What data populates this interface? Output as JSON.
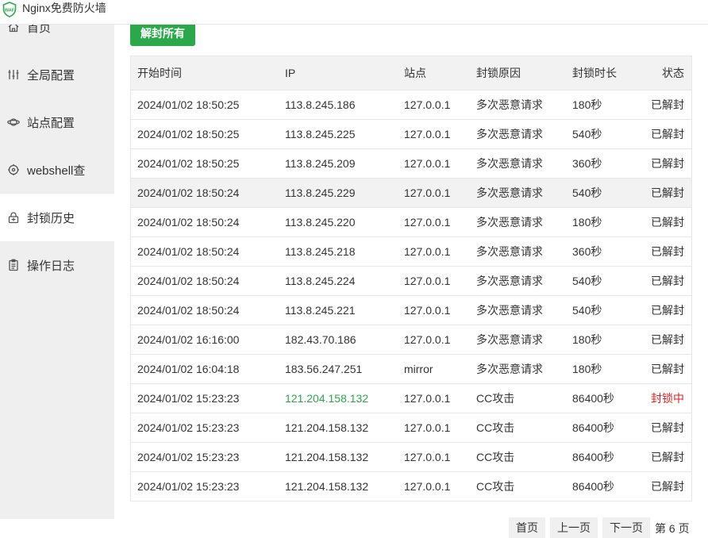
{
  "app": {
    "title": "Nginx免费防火墙",
    "logo_text": "WAF"
  },
  "sidebar": {
    "items": [
      {
        "label": "首页",
        "icon": "home-icon"
      },
      {
        "label": "全局配置",
        "icon": "sliders-icon"
      },
      {
        "label": "站点配置",
        "icon": "planet-icon"
      },
      {
        "label": "webshell查",
        "icon": "target-icon"
      },
      {
        "label": "封锁历史",
        "icon": "lock-icon",
        "active": true
      },
      {
        "label": "操作日志",
        "icon": "clipboard-icon"
      }
    ]
  },
  "toolbar": {
    "unblock_all_label": "解封所有"
  },
  "table": {
    "headers": [
      "开始时间",
      "IP",
      "站点",
      "封锁原因",
      "封锁时长",
      "状态"
    ],
    "rows": [
      [
        "2024/01/02 18:50:25",
        "113.8.245.186",
        "127.0.0.1",
        "多次恶意请求",
        "180秒",
        "已解封"
      ],
      [
        "2024/01/02 18:50:25",
        "113.8.245.225",
        "127.0.0.1",
        "多次恶意请求",
        "540秒",
        "已解封"
      ],
      [
        "2024/01/02 18:50:25",
        "113.8.245.209",
        "127.0.0.1",
        "多次恶意请求",
        "360秒",
        "已解封"
      ],
      [
        "2024/01/02 18:50:24",
        "113.8.245.229",
        "127.0.0.1",
        "多次恶意请求",
        "540秒",
        "已解封"
      ],
      [
        "2024/01/02 18:50:24",
        "113.8.245.220",
        "127.0.0.1",
        "多次恶意请求",
        "180秒",
        "已解封"
      ],
      [
        "2024/01/02 18:50:24",
        "113.8.245.218",
        "127.0.0.1",
        "多次恶意请求",
        "360秒",
        "已解封"
      ],
      [
        "2024/01/02 18:50:24",
        "113.8.245.224",
        "127.0.0.1",
        "多次恶意请求",
        "540秒",
        "已解封"
      ],
      [
        "2024/01/02 18:50:24",
        "113.8.245.221",
        "127.0.0.1",
        "多次恶意请求",
        "540秒",
        "已解封"
      ],
      [
        "2024/01/02 16:16:00",
        "182.43.70.186",
        "127.0.0.1",
        "多次恶意请求",
        "180秒",
        "已解封"
      ],
      [
        "2024/01/02 16:04:18",
        "183.56.247.251",
        "mirror",
        "多次恶意请求",
        "180秒",
        "已解封"
      ],
      [
        "2024/01/02 15:23:23",
        "121.204.158.132",
        "127.0.0.1",
        "CC攻击",
        "86400秒",
        "封锁中"
      ],
      [
        "2024/01/02 15:23:23",
        "121.204.158.132",
        "127.0.0.1",
        "CC攻击",
        "86400秒",
        "已解封"
      ],
      [
        "2024/01/02 15:23:23",
        "121.204.158.132",
        "127.0.0.1",
        "CC攻击",
        "86400秒",
        "已解封"
      ],
      [
        "2024/01/02 15:23:23",
        "121.204.158.132",
        "127.0.0.1",
        "CC攻击",
        "86400秒",
        "已解封"
      ]
    ]
  },
  "pager": {
    "first": "首页",
    "prev": "上一页",
    "next": "下一页",
    "info": "第 6 页"
  },
  "colors": {
    "accent": "#2aa84a",
    "blocked": "#e02424"
  }
}
